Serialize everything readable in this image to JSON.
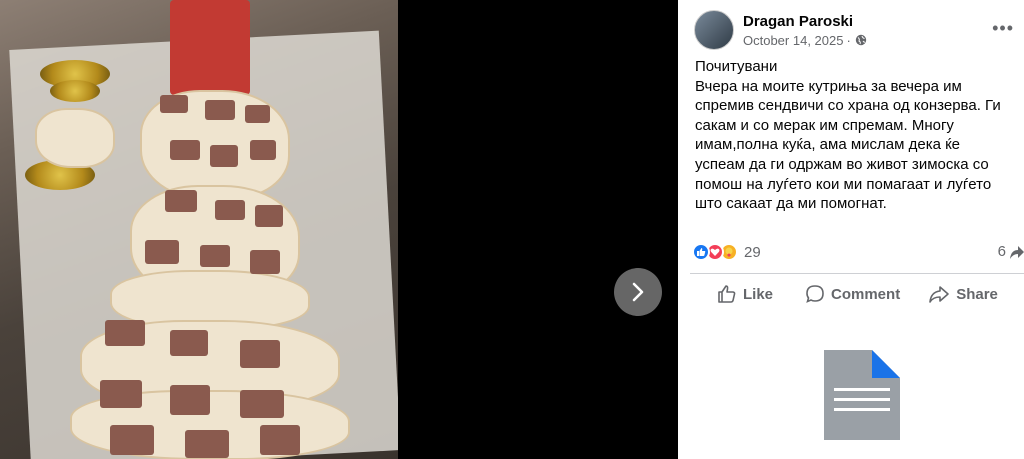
{
  "post": {
    "author": "Dragan Paroski",
    "date": "October 14, 2025",
    "privacy_icon": "globe-icon",
    "lines": [
      "Почитувани",
      "Вчера на моите кутриња за вечера им",
      "спремив сендвичи со храна од конзерва. Ги",
      "сакам и со мерак им спремам. Многу",
      "имам,полна куќа, ама мислам дека ќе",
      "успеам да ги одржам во живот зимоска со",
      "помош на луѓето кои ми помагаат и луѓето",
      "што сакаат да ми помогнат."
    ]
  },
  "reactions": {
    "count": "29",
    "shares": "6",
    "icons": [
      "like-icon",
      "love-icon",
      "care-icon"
    ]
  },
  "actions": {
    "like": "Like",
    "comment": "Comment",
    "share": "Share"
  },
  "colors": {
    "like_blue": "#1877f2",
    "love_red": "#f33e58",
    "care_yellow": "#f7b125",
    "muted": "#65676b"
  }
}
